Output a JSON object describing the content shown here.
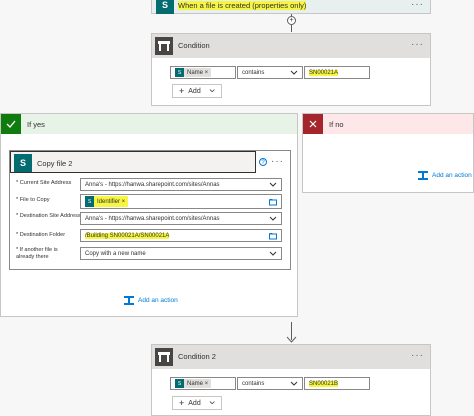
{
  "trigger": {
    "title": "When a file is created (properties only)"
  },
  "condition1": {
    "title": "Condition",
    "left_token": "Name",
    "operator": "contains",
    "value": "SN00021A",
    "add_label": "Add"
  },
  "if_yes": {
    "label": "If yes",
    "copy": {
      "title": "Copy file 2",
      "fields": [
        {
          "label": "* Current Site Address",
          "value": "Anna's - https://hanwa.sharepoint.com/sites/Annas"
        },
        {
          "label": "* File to Copy",
          "token": "Identifier"
        },
        {
          "label": "* Destination Site Address",
          "value": "Anna's - https://hanwa.sharepoint.com/sites/Annas"
        },
        {
          "label": "* Destination Folder",
          "value": "/Building SN00021A/SN00021A"
        },
        {
          "label": "* If another file is already there",
          "value": "Copy with a new name"
        }
      ]
    },
    "add_action": "Add an action"
  },
  "if_no": {
    "label": "If no",
    "add_action": "Add an action"
  },
  "condition2": {
    "title": "Condition 2",
    "left_token": "Name",
    "operator": "contains",
    "value": "SN00021B",
    "add_label": "Add"
  },
  "colors": {
    "yes_green": "#107c10",
    "no_red": "#a4262c",
    "highlight": "#f5f542",
    "sharepoint": "#036c70"
  }
}
